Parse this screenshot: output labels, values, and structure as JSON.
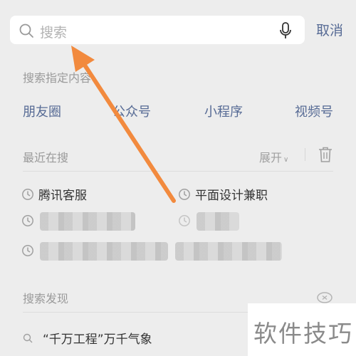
{
  "search": {
    "placeholder": "搜索",
    "cancel_label": "取消"
  },
  "specified": {
    "label": "搜索指定内容",
    "types": [
      "朋友圈",
      "公众号",
      "小程序",
      "视频号"
    ]
  },
  "recent": {
    "label": "最近在搜",
    "expand_label": "展开",
    "items": [
      "腾讯客服",
      "平面设计兼职"
    ]
  },
  "discover": {
    "label": "搜索发现",
    "items": [
      "“千万工程”万千气象"
    ]
  },
  "watermark": {
    "text": "软件技巧"
  },
  "colors": {
    "accent": "#576b95",
    "arrow": "#f28a3e",
    "background": "#ededed"
  }
}
